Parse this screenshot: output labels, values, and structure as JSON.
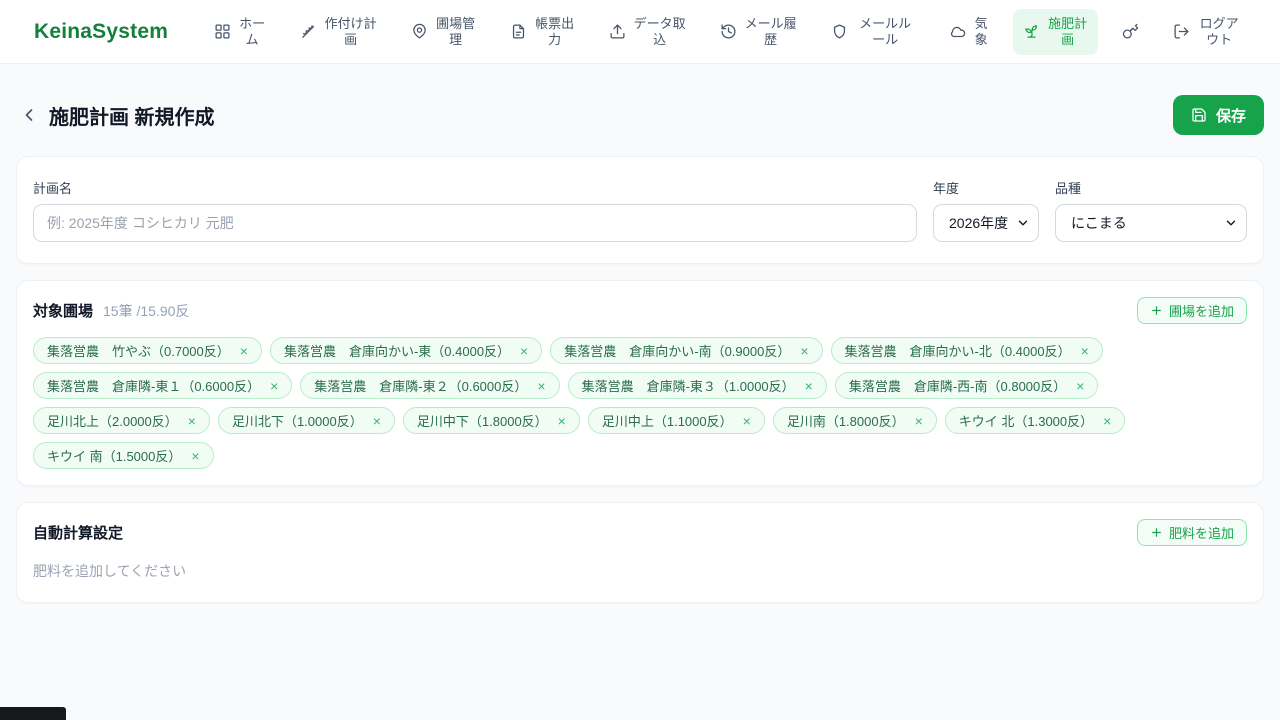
{
  "brand": "KeinaSystem",
  "nav": {
    "items": [
      {
        "label": "ホーム",
        "icon": "home-grid-icon",
        "active": false
      },
      {
        "label": "作付け計画",
        "icon": "wheat-icon",
        "active": false
      },
      {
        "label": "圃場管理",
        "icon": "map-pin-icon",
        "active": false
      },
      {
        "label": "帳票出力",
        "icon": "document-icon",
        "active": false
      },
      {
        "label": "データ取込",
        "icon": "upload-icon",
        "active": false
      },
      {
        "label": "メール履歴",
        "icon": "history-icon",
        "active": false
      },
      {
        "label": "メールルール",
        "icon": "shield-icon",
        "active": false
      },
      {
        "label": "気象",
        "icon": "cloud-icon",
        "active": false
      },
      {
        "label": "施肥計画",
        "icon": "sprout-icon",
        "active": true
      },
      {
        "label": "",
        "icon": "key-icon",
        "active": false
      },
      {
        "label": "ログアウト",
        "icon": "logout-icon",
        "active": false
      }
    ]
  },
  "header": {
    "title": "施肥計画 新規作成",
    "save_label": "保存"
  },
  "plan_form": {
    "name_label": "計画名",
    "name_value": "",
    "name_placeholder": "例: 2025年度 コシヒカリ 元肥",
    "year_label": "年度",
    "year_value": "2026年度",
    "variety_label": "品種",
    "variety_value": "にこまる"
  },
  "target_fields": {
    "title": "対象圃場",
    "count_text": "15筆 /15.90反",
    "add_label": "圃場を追加",
    "remove_glyph": "×",
    "chips": [
      "集落営農　竹やぶ（0.7000反）",
      "集落営農　倉庫向かい-東（0.4000反）",
      "集落営農　倉庫向かい-南（0.9000反）",
      "集落営農　倉庫向かい-北（0.4000反）",
      "集落営農　倉庫隣-東１（0.6000反）",
      "集落営農　倉庫隣-東２（0.6000反）",
      "集落営農　倉庫隣-東３（1.0000反）",
      "集落営農　倉庫隣-西-南（0.8000反）",
      "足川北上（2.0000反）",
      "足川北下（1.0000反）",
      "足川中下（1.8000反）",
      "足川中上（1.1000反）",
      "足川南（1.8000反）",
      "キウイ 北（1.3000反）",
      "キウイ 南（1.5000反）"
    ]
  },
  "auto_calc": {
    "title": "自動計算設定",
    "add_label": "肥料を追加",
    "empty_text": "肥料を追加してください"
  },
  "colors": {
    "brand_green": "#15803d",
    "accent_green": "#16a34a",
    "active_nav_bg": "#e9f8ef",
    "chip_bg": "#f1fcf5",
    "chip_border": "#b9ecc9",
    "chip_text": "#2a6c4b",
    "page_bg": "#f8fafc",
    "muted_text": "#94a3b8"
  }
}
